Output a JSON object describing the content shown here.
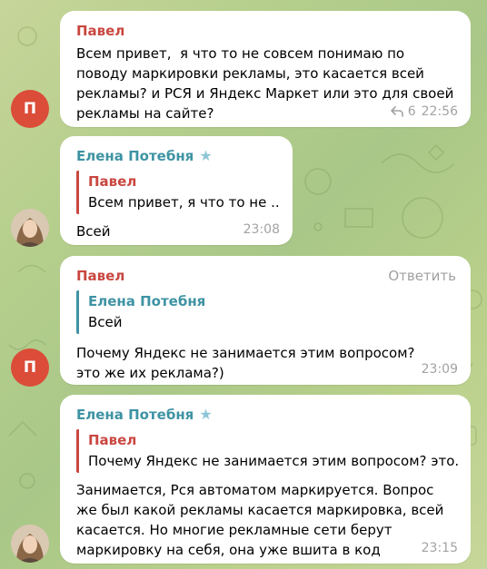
{
  "colors": {
    "author_red": "#c94740",
    "author_blue": "#3e93a3",
    "avatar_red": "#db4c39",
    "timestamp": "#a3a3a3"
  },
  "messages": [
    {
      "author": "Павел",
      "text": "Всем привет,  я что то не совсем понимаю по поводу маркировки рекламы, это касается всей рекламы? и РСЯ и Яндекс Маркет или это для своей рекламы на сайте?",
      "replies_count": "6",
      "time": "22:56",
      "avatar_initial": "П"
    },
    {
      "author": "Елена Потебня",
      "badge_icon": "star-icon",
      "quote_author": "Павел",
      "quote_text": "Всем привет,  я что то не ...",
      "text": "Всей",
      "time": "23:08"
    },
    {
      "author": "Павел",
      "reply_link": "Ответить",
      "quote_author": "Елена Потебня",
      "quote_text": "Всей",
      "text": "Почему Яндекс не занимается этим вопросом? это же их реклама?)",
      "time": "23:09",
      "avatar_initial": "П"
    },
    {
      "author": "Елена Потебня",
      "badge_icon": "star-icon",
      "quote_author": "Павел",
      "quote_text": "Почему Яндекс не занимается этим вопросом? это...",
      "text": "Занимается, Рся автоматом маркируется. Вопрос же был какой рекламы касается маркировка, всей касается. Но многие рекламные сети берут маркировку на себя, она уже вшита в код",
      "time": "23:15"
    }
  ]
}
